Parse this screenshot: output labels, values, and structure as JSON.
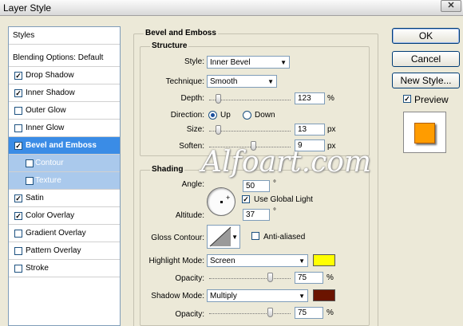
{
  "window": {
    "title": "Layer Style",
    "close_icon": "close-icon"
  },
  "styles_list": {
    "header": "Styles",
    "blending": "Blending Options: Default",
    "items": [
      {
        "label": "Drop Shadow",
        "checked": true
      },
      {
        "label": "Inner Shadow",
        "checked": true
      },
      {
        "label": "Outer Glow",
        "checked": false
      },
      {
        "label": "Inner Glow",
        "checked": false
      },
      {
        "label": "Bevel and Emboss",
        "checked": true,
        "selected": true
      },
      {
        "label": "Contour",
        "checked": false,
        "sub": true
      },
      {
        "label": "Texture",
        "checked": false,
        "sub": true
      },
      {
        "label": "Satin",
        "checked": true
      },
      {
        "label": "Color Overlay",
        "checked": true
      },
      {
        "label": "Gradient Overlay",
        "checked": false
      },
      {
        "label": "Pattern Overlay",
        "checked": false
      },
      {
        "label": "Stroke",
        "checked": false
      }
    ]
  },
  "panel": {
    "title": "Bevel and Emboss",
    "structure": {
      "title": "Structure",
      "style_label": "Style:",
      "style_value": "Inner Bevel",
      "technique_label": "Technique:",
      "technique_value": "Smooth",
      "depth_label": "Depth:",
      "depth_value": "123",
      "depth_unit": "%",
      "direction_label": "Direction:",
      "direction_up": "Up",
      "direction_down": "Down",
      "direction_selected": "Up",
      "size_label": "Size:",
      "size_value": "13",
      "size_unit": "px",
      "soften_label": "Soften:",
      "soften_value": "9",
      "soften_unit": "px"
    },
    "shading": {
      "title": "Shading",
      "angle_label": "Angle:",
      "angle_value": "50",
      "angle_unit": "°",
      "global_light_label": "Use Global Light",
      "global_light_checked": true,
      "altitude_label": "Altitude:",
      "altitude_value": "37",
      "altitude_unit": "°",
      "gloss_label": "Gloss Contour:",
      "anti_aliased_label": "Anti-aliased",
      "anti_aliased_checked": false,
      "highlight_mode_label": "Highlight Mode:",
      "highlight_mode_value": "Screen",
      "highlight_color": "#ffff00",
      "highlight_opacity_label": "Opacity:",
      "highlight_opacity_value": "75",
      "highlight_opacity_unit": "%",
      "shadow_mode_label": "Shadow Mode:",
      "shadow_mode_value": "Multiply",
      "shadow_color": "#6b1400",
      "shadow_opacity_label": "Opacity:",
      "shadow_opacity_value": "75",
      "shadow_opacity_unit": "%"
    }
  },
  "buttons": {
    "ok": "OK",
    "cancel": "Cancel",
    "new_style": "New Style...",
    "preview": "Preview",
    "preview_checked": true
  },
  "watermark": "Alfoart.com"
}
